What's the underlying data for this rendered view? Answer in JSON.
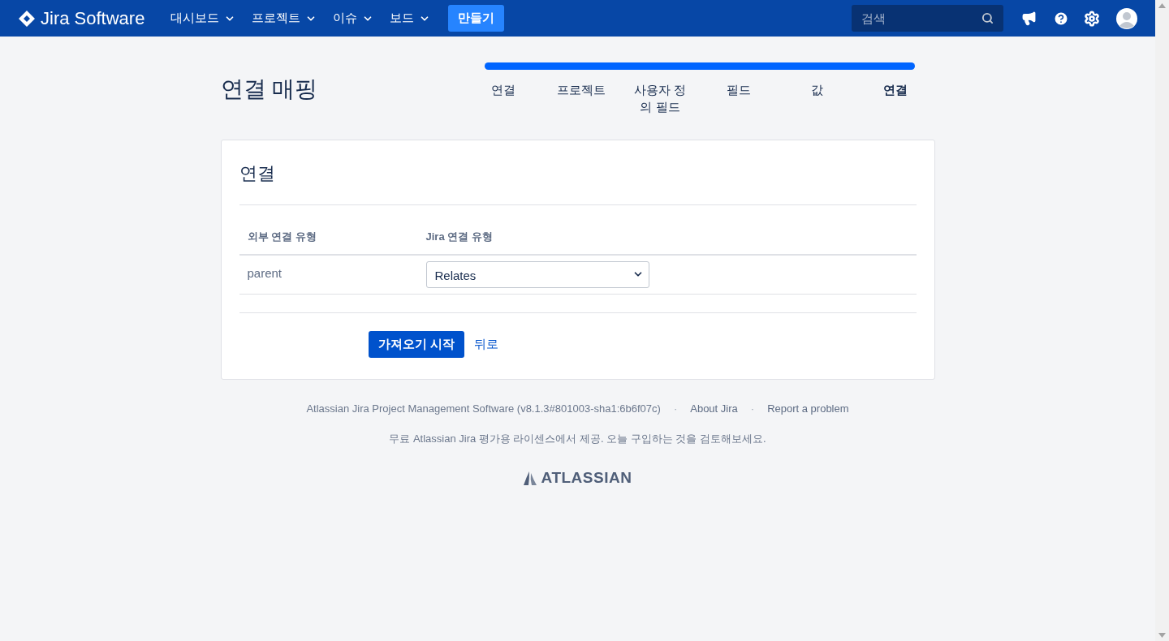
{
  "header": {
    "logo_text": "Jira Software",
    "nav": [
      "대시보드",
      "프로젝트",
      "이슈",
      "보드"
    ],
    "create_button": "만들기",
    "search": {
      "placeholder": "검색"
    }
  },
  "page_title": "연결 매핑",
  "progress": {
    "level": 1,
    "steps": [
      {
        "label": "연결",
        "selected": false
      },
      {
        "label": "프로젝트",
        "selected": false
      },
      {
        "label": "사용자 정의 필드",
        "selected": false
      },
      {
        "label": "필드",
        "selected": false
      },
      {
        "label": "값",
        "selected": false
      },
      {
        "label": "연결",
        "selected": true
      }
    ]
  },
  "panel": {
    "title": "연결",
    "table": {
      "columns": [
        "외부 연결 유형",
        "Jira 연결 유형"
      ],
      "rows": [
        {
          "external": "parent",
          "jira": "Relates"
        }
      ]
    },
    "buttons": {
      "primary": "가져오기 시작",
      "link": "뒤로"
    }
  },
  "footer": {
    "links": [
      {
        "text": "Atlassian Jira Project Management Software (v8.1.3#801003-sha1:6b6f07c)",
        "kind": "text"
      },
      {
        "text": "·",
        "kind": "separator"
      },
      {
        "text": "About Jira",
        "kind": "link"
      },
      {
        "text": "·",
        "kind": "separator"
      },
      {
        "text": "Report a problem",
        "kind": "link"
      }
    ],
    "license": "무료 Atlassian Jira 평가용 라이센스에서 제공. 오늘 구입하는 것을 검토해보세요.",
    "brand": "ATLASSIAN"
  }
}
